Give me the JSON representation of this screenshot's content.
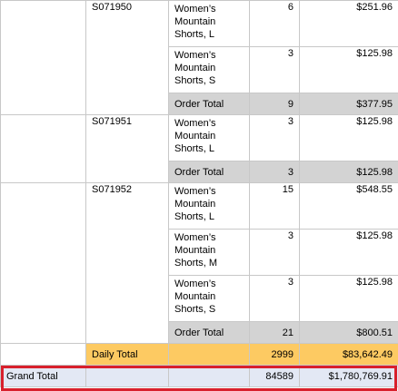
{
  "report": {
    "orders": [
      {
        "id": "S071950",
        "items": [
          {
            "product": "Women’s Mountain Shorts, L",
            "qty": "6",
            "total": "$251.96"
          },
          {
            "product": "Women’s Mountain Shorts, S",
            "qty": "3",
            "total": "$125.98"
          }
        ],
        "order_total_label": "Order Total",
        "order_total_qty": "9",
        "order_total_amount": "$377.95"
      },
      {
        "id": "S071951",
        "items": [
          {
            "product": "Women’s Mountain Shorts, L",
            "qty": "3",
            "total": "$125.98"
          }
        ],
        "order_total_label": "Order Total",
        "order_total_qty": "3",
        "order_total_amount": "$125.98"
      },
      {
        "id": "S071952",
        "items": [
          {
            "product": "Women’s Mountain Shorts, L",
            "qty": "15",
            "total": "$548.55"
          },
          {
            "product": "Women’s Mountain Shorts, M",
            "qty": "3",
            "total": "$125.98"
          },
          {
            "product": "Women’s Mountain Shorts, S",
            "qty": "3",
            "total": "$125.98"
          }
        ],
        "order_total_label": "Order Total",
        "order_total_qty": "21",
        "order_total_amount": "$800.51"
      }
    ],
    "daily_total": {
      "label": "Daily Total",
      "qty": "2999",
      "amount": "$83,642.49"
    },
    "grand_total": {
      "label": "Grand Total",
      "qty": "84589",
      "amount": "$1,780,769.91"
    }
  },
  "colors": {
    "subtotal_bg": "#d3d3d3",
    "daily_bg": "#fdca62",
    "grand_bg": "#e3e8f4",
    "highlight_outline": "#d8202c",
    "grid_line": "#c8c8c8"
  }
}
